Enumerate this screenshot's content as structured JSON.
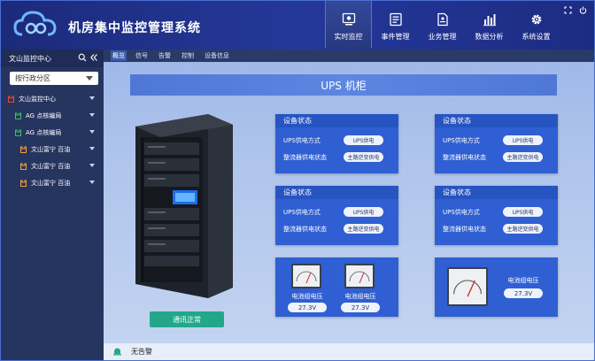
{
  "header": {
    "title": "机房集中监控管理系统"
  },
  "nav": [
    {
      "label": "实时监控",
      "icon": "monitor-icon",
      "active": true
    },
    {
      "label": "事件管理",
      "icon": "event-list-icon"
    },
    {
      "label": "业务管理",
      "icon": "document-icon"
    },
    {
      "label": "数据分析",
      "icon": "bar-chart-icon"
    },
    {
      "label": "系统设置",
      "icon": "gear-icon"
    }
  ],
  "sidebar": {
    "title": "文山监控中心",
    "region_select": "按行政分区",
    "tree": [
      {
        "label": "文山监控中心",
        "level": 0
      },
      {
        "label": "AG 点核编局",
        "level": 1
      },
      {
        "label": "AG 点核编局",
        "level": 1
      },
      {
        "label": "文山富宁 百油",
        "level": 2
      },
      {
        "label": "文山富宁 百油",
        "level": 2
      },
      {
        "label": "文山富宁 百油",
        "level": 2
      }
    ]
  },
  "tabs": [
    "概览",
    "信号",
    "告警",
    "控制",
    "设备信息"
  ],
  "main": {
    "title": "UPS 机柜",
    "comm_status": "通讯正常",
    "cards": [
      {
        "head": "设备状态",
        "rows": [
          {
            "label": "UPS供电方式",
            "value": "UPS供电"
          },
          {
            "label": "整流器供电状态",
            "value": "主路逆变供电"
          }
        ]
      },
      {
        "head": "设备状态",
        "rows": [
          {
            "label": "UPS供电方式",
            "value": "UPS供电"
          },
          {
            "label": "整流器供电状态",
            "value": "主路逆变供电"
          }
        ]
      },
      {
        "head": "设备状态",
        "rows": [
          {
            "label": "UPS供电方式",
            "value": "UPS供电"
          },
          {
            "label": "整流器供电状态",
            "value": "主路逆变供电"
          }
        ]
      },
      {
        "head": "设备状态",
        "rows": [
          {
            "label": "UPS供电方式",
            "value": "UPS供电"
          },
          {
            "label": "整流器供电状态",
            "value": "主路逆变供电"
          }
        ]
      }
    ],
    "meters_left": [
      {
        "label": "电池组电压",
        "value": "27.3V"
      },
      {
        "label": "电池组电压",
        "value": "27.3V"
      }
    ],
    "meter_right": {
      "label": "电池组电压",
      "value": "27.3V"
    }
  },
  "status": {
    "text": "无告警"
  },
  "colors": {
    "accent": "#2f5fd2",
    "ok": "#22a889",
    "header": "#1c2a7a"
  }
}
